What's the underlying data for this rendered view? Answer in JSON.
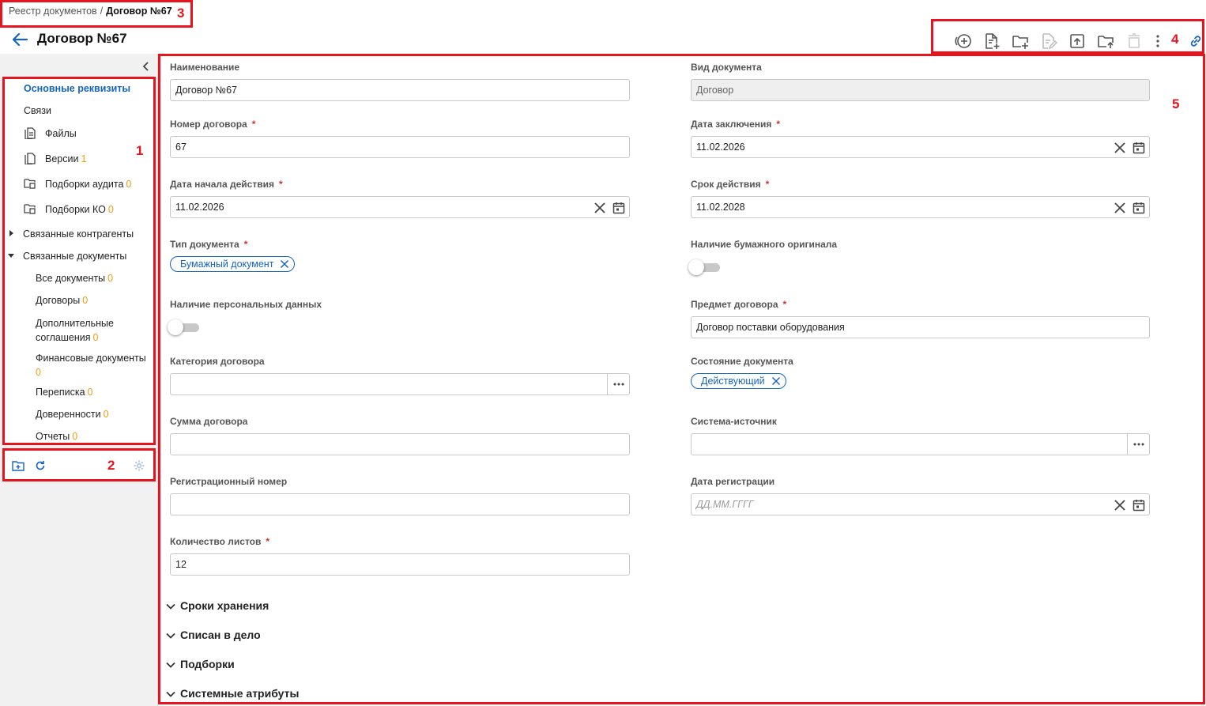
{
  "breadcrumb": {
    "parent": "Реестр документов",
    "separator": "/",
    "current": "Договор №67"
  },
  "page": {
    "title": "Договор №67"
  },
  "toolbar": {
    "icons": [
      "add-circle-icon",
      "new-document-icon",
      "new-folder-icon",
      "edit-document-icon",
      "upload-icon",
      "move-to-folder-icon",
      "delete-icon",
      "more-vertical-icon",
      "link-icon"
    ]
  },
  "annotations": {
    "n1": "1",
    "n2": "2",
    "n3": "3",
    "n4": "4",
    "n5": "5"
  },
  "sidebar": {
    "items": {
      "main": "Основные реквизиты",
      "links": "Связи",
      "files": "Файлы",
      "versions": {
        "label": "Версии",
        "count": "1"
      },
      "audit": {
        "label": "Подборки аудита",
        "count": "0"
      },
      "ko": {
        "label": "Подборки КО",
        "count": "0"
      },
      "contragents": "Связанные контрагенты",
      "related": "Связанные документы",
      "all_docs": {
        "label": "Все документы",
        "count": "0"
      },
      "contracts": {
        "label": "Договоры",
        "count": "0"
      },
      "additional": {
        "line1": "Дополнительные",
        "line2": "соглашения",
        "count": "0"
      },
      "financial": {
        "label": "Финансовые документы",
        "count": "0"
      },
      "correspondence": {
        "label": "Переписка",
        "count": "0"
      },
      "powers": {
        "label": "Доверенности",
        "count": "0"
      },
      "reports": {
        "label": "Отчеты",
        "count": "0"
      }
    }
  },
  "form": {
    "name": {
      "label": "Наименование",
      "value": "Договор №67"
    },
    "doc_kind": {
      "label": "Вид документа",
      "value": "Договор"
    },
    "contract_number": {
      "label": "Номер договора",
      "required": "*",
      "value": "67"
    },
    "conclusion_date": {
      "label": "Дата заключения",
      "required": "*",
      "value": "11.02.2026"
    },
    "start_date": {
      "label": "Дата начала действия",
      "required": "*",
      "value": "11.02.2026"
    },
    "validity": {
      "label": "Срок действия",
      "required": "*",
      "value": "11.02.2028"
    },
    "doc_type": {
      "label": "Тип документа",
      "required": "*",
      "chip": "Бумажный документ"
    },
    "paper_original": {
      "label": "Наличие бумажного оригинала",
      "on": false
    },
    "personal_data": {
      "label": "Наличие персональных данных",
      "on": false
    },
    "subject": {
      "label": "Предмет договора",
      "required": "*",
      "value": "Договор поставки оборудования"
    },
    "category": {
      "label": "Категория договора",
      "value": ""
    },
    "state": {
      "label": "Состояние документа",
      "chip": "Действующий"
    },
    "amount": {
      "label": "Сумма договора",
      "value": ""
    },
    "source_system": {
      "label": "Система-источник",
      "value": ""
    },
    "reg_number": {
      "label": "Регистрационный номер",
      "value": ""
    },
    "reg_date": {
      "label": "Дата регистрации",
      "placeholder": "ДД.ММ.ГГГГ"
    },
    "sheets": {
      "label": "Количество листов",
      "required": "*",
      "value": "12"
    }
  },
  "sections": [
    "Сроки хранения",
    "Списан в дело",
    "Подборки",
    "Системные атрибуты"
  ],
  "colors": {
    "accent": "#1565c0",
    "count": "#f39c12",
    "required": "#d32f2f",
    "annotation": "#e8141d"
  }
}
